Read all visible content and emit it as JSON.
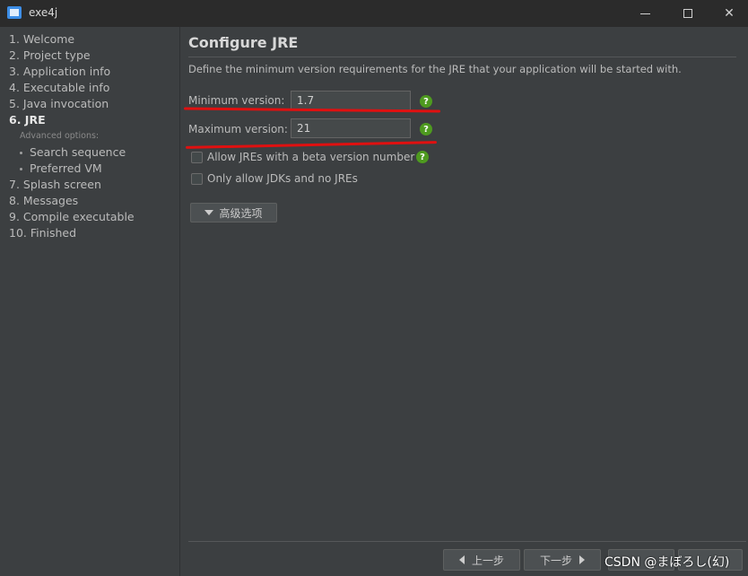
{
  "window": {
    "title": "exe4j"
  },
  "sidebar": {
    "steps": [
      "1. Welcome",
      "2. Project type",
      "3. Application info",
      "4. Executable info",
      "5. Java invocation",
      "6. JRE"
    ],
    "advanced_label": "Advanced options:",
    "sub_items": [
      "Search sequence",
      "Preferred VM"
    ],
    "steps_after": [
      "7. Splash screen",
      "8. Messages",
      "9. Compile executable",
      "10. Finished"
    ]
  },
  "main": {
    "heading": "Configure JRE",
    "description": "Define the minimum version requirements for the JRE that your application will be started with.",
    "min_label": "Minimum version:",
    "min_value": "1.7",
    "max_label": "Maximum version:",
    "max_value": "21",
    "help_glyph": "?",
    "beta_label": "Allow JREs with a beta version number",
    "jdk_label": "Only allow JDKs and no JREs",
    "advanced_button": "高级选项"
  },
  "footer": {
    "back_label": "上一步",
    "next_label": "下一步"
  },
  "watermark": "CSDN @まぼろし(幻)",
  "colors": {
    "background": "#3c3f41",
    "annotation": "#e01010",
    "help": "#4e9a1f"
  }
}
